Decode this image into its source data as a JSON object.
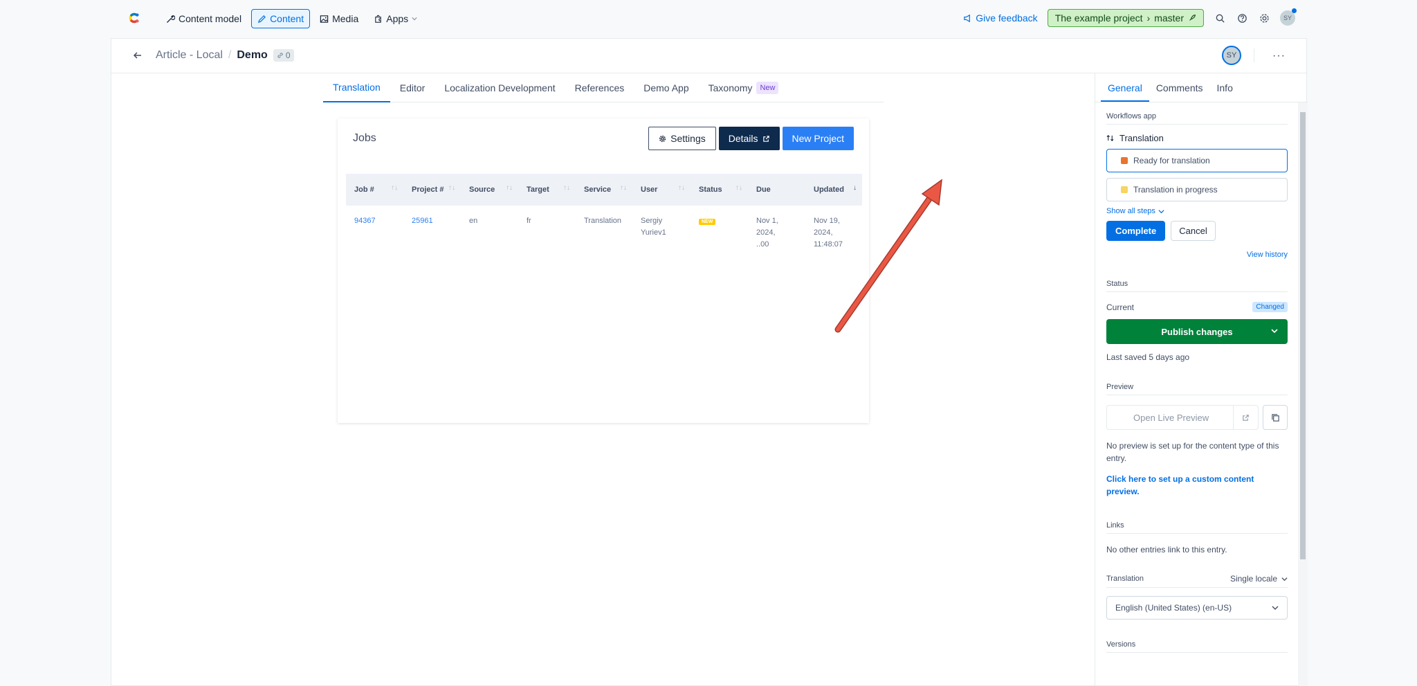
{
  "topbar": {
    "nav": [
      {
        "label": "Content model",
        "icon": "wrench-icon"
      },
      {
        "label": "Content",
        "icon": "pencil-icon"
      },
      {
        "label": "Media",
        "icon": "image-icon"
      },
      {
        "label": "Apps",
        "icon": "puzzle-icon"
      }
    ],
    "feedback": "Give feedback",
    "env_project": "The example project",
    "env_branch": "master",
    "avatar": "SY"
  },
  "entry": {
    "content_type": "Article - Local",
    "title": "Demo",
    "ref_count": "0",
    "avatar": "SY",
    "more": "···"
  },
  "tabs": [
    {
      "label": "Translation"
    },
    {
      "label": "Editor"
    },
    {
      "label": "Localization Development"
    },
    {
      "label": "References"
    },
    {
      "label": "Demo App"
    },
    {
      "label": "Taxonomy",
      "badge": "New"
    }
  ],
  "jobs": {
    "title": "Jobs",
    "settings": "Settings",
    "details": "Details",
    "new_project": "New Project",
    "columns": [
      "Job #",
      "Project #",
      "Source",
      "Target",
      "Service",
      "User",
      "Status",
      "Due",
      "Updated"
    ],
    "rows": [
      {
        "job": "94367",
        "project": "25961",
        "source": "en",
        "target": "fr",
        "service": "Translation",
        "user_line1": "Sergiy",
        "user_line2": "Yuriev1",
        "status": "NEW",
        "due_line1": "Nov 1,",
        "due_line2": "2024,",
        "due_line3": "..00",
        "updated_line1": "Nov 19,",
        "updated_line2": "2024,",
        "updated_line3": "11:48:07"
      }
    ]
  },
  "sidebar": {
    "tabs": [
      "General",
      "Comments",
      "Info"
    ],
    "workflows_label": "Workflows app",
    "workflow_name": "Translation",
    "steps": [
      {
        "label": "Ready for translation",
        "color": "#e8742f"
      },
      {
        "label": "Translation in progress",
        "color": "#f5d563"
      }
    ],
    "show_all_steps": "Show all steps",
    "complete": "Complete",
    "cancel": "Cancel",
    "view_history": "View history",
    "status_label": "Status",
    "current": "Current",
    "changed": "Changed",
    "publish": "Publish changes",
    "last_saved": "Last saved 5 days ago",
    "preview_label": "Preview",
    "open_live_preview": "Open Live Preview",
    "no_preview": "No preview is set up for the content type of this entry.",
    "setup_preview": "Click here to set up a custom content preview.",
    "links_label": "Links",
    "no_links": "No other entries link to this entry.",
    "translation_label": "Translation",
    "locale_mode": "Single locale",
    "locale_value": "English (United States) (en-US)",
    "versions_label": "Versions"
  }
}
